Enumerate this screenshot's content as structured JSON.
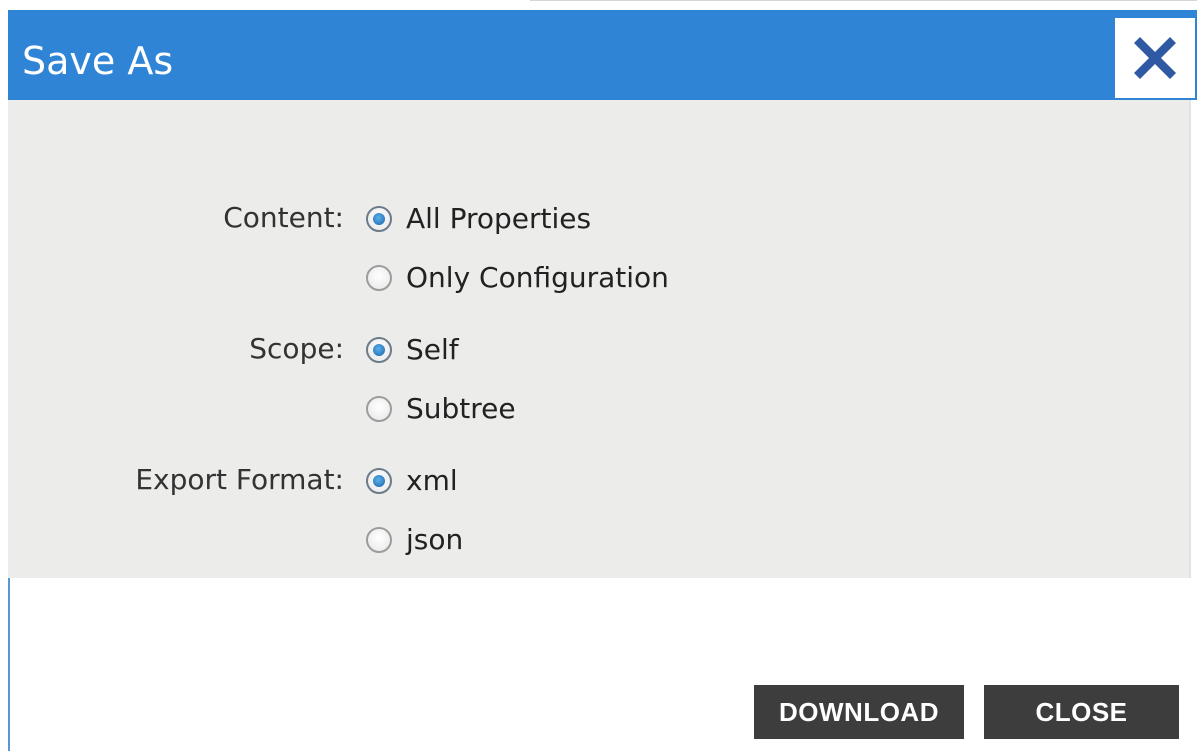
{
  "dialog": {
    "title": "Save As",
    "close_icon": "close-x-icon",
    "accent_color": "#2f84d6"
  },
  "form": {
    "content": {
      "label": "Content:",
      "options": [
        {
          "label": "All Properties",
          "checked": true
        },
        {
          "label": "Only Configuration",
          "checked": false
        }
      ]
    },
    "scope": {
      "label": "Scope:",
      "options": [
        {
          "label": "Self",
          "checked": true
        },
        {
          "label": "Subtree",
          "checked": false
        }
      ]
    },
    "export_format": {
      "label": "Export Format:",
      "options": [
        {
          "label": "xml",
          "checked": true
        },
        {
          "label": "json",
          "checked": false
        }
      ]
    }
  },
  "buttons": {
    "download_label": "DOWNLOAD",
    "close_label": "CLOSE"
  }
}
